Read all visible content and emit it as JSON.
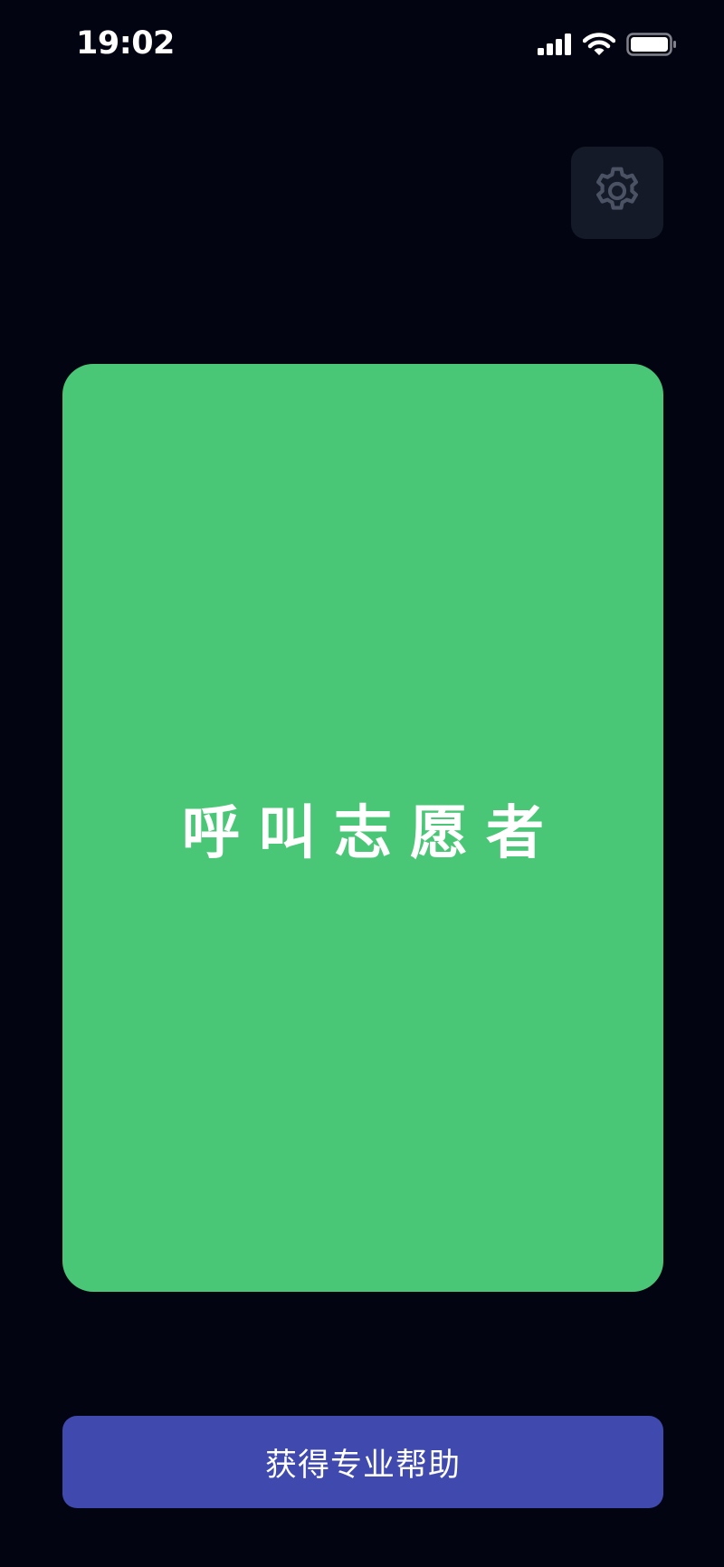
{
  "status_bar": {
    "time": "19:02",
    "icons": [
      "signal-icon",
      "wifi-icon",
      "battery-icon"
    ]
  },
  "settings": {
    "icon": "gear-icon"
  },
  "call_card": {
    "label": "呼叫志愿者",
    "color": "#4ac776"
  },
  "help_button": {
    "label": "获得专业帮助",
    "color": "#3f49ae"
  },
  "theme": {
    "background": "#020412",
    "settings_bg": "#141a27",
    "icon_color": "#4b5263"
  }
}
